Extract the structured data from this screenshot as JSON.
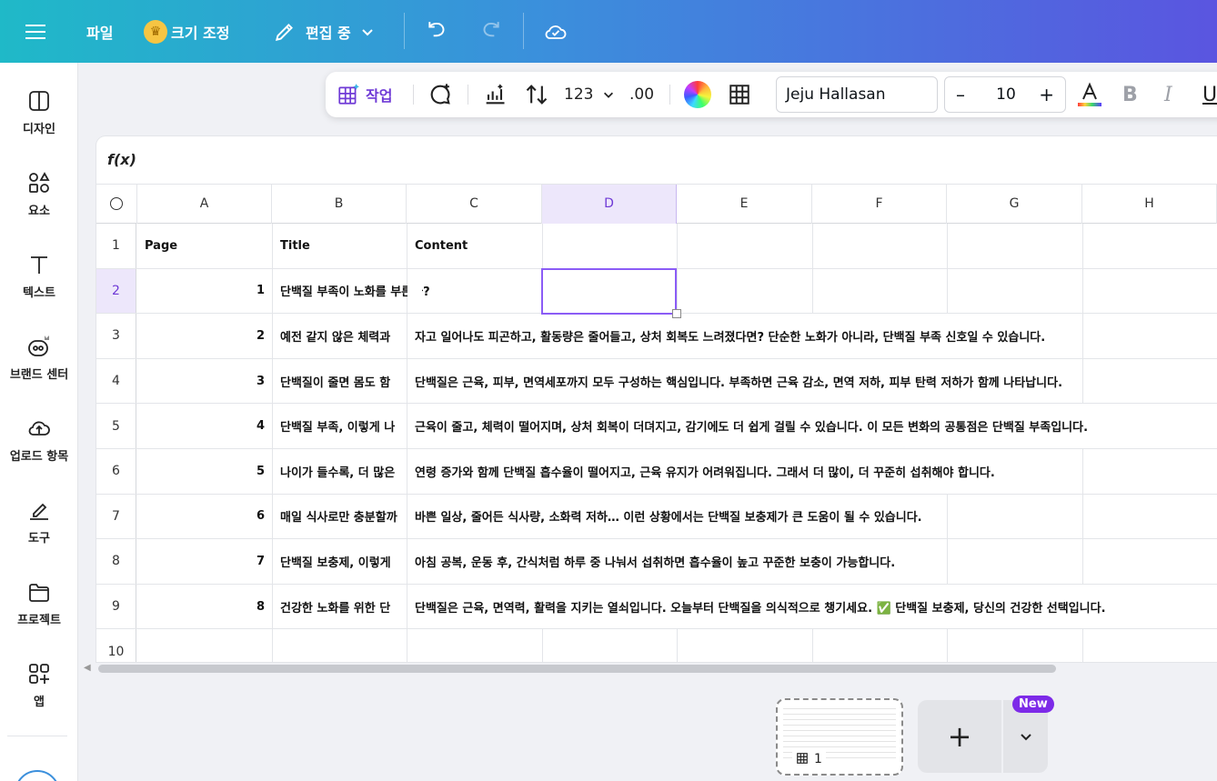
{
  "topbar": {
    "file_label": "파일",
    "resize_label": "크기 조정",
    "edit_mode_label": "편집 중"
  },
  "sidebar": {
    "items": [
      {
        "label": "디자인",
        "icon": "design-icon"
      },
      {
        "label": "요소",
        "icon": "elements-icon"
      },
      {
        "label": "텍스트",
        "icon": "text-icon"
      },
      {
        "label": "브랜드 센터",
        "icon": "brand-icon"
      },
      {
        "label": "업로드 항목",
        "icon": "upload-icon"
      },
      {
        "label": "도구",
        "icon": "tools-icon"
      },
      {
        "label": "프로젝트",
        "icon": "folder-icon"
      },
      {
        "label": "앱",
        "icon": "apps-icon"
      }
    ]
  },
  "toolbar": {
    "work_label": "작업",
    "number_format": "123",
    "decimal": ".00",
    "font_name": "Jeju Hallasan",
    "font_size": "10",
    "bold": "B",
    "italic": "I",
    "underline": "U"
  },
  "formula_bar": {
    "label": "f(x)"
  },
  "sheet": {
    "columns": [
      "A",
      "B",
      "C",
      "D",
      "E",
      "F",
      "G",
      "H"
    ],
    "selected_column": "D",
    "selected_row": "2",
    "rows": [
      {
        "num": "1",
        "a": "Page",
        "b": "Title",
        "c": "Content"
      },
      {
        "num": "2",
        "a": "1",
        "b": "단백질 부족이 노화를 부른다?",
        "c": ""
      },
      {
        "num": "3",
        "a": "2",
        "b": "예전 같지 않은 체력과",
        "c": "자고 일어나도 피곤하고, 활동량은 줄어들고, 상처 회복도 느려졌다면? 단순한 노화가 아니라, 단백질 부족 신호일 수 있습니다."
      },
      {
        "num": "4",
        "a": "3",
        "b": "단백질이 줄면 몸도 함",
        "c": "단백질은 근육, 피부, 면역세포까지 모두 구성하는 핵심입니다. 부족하면 근육 감소, 면역 저하, 피부 탄력 저하가 함께 나타납니다."
      },
      {
        "num": "5",
        "a": "4",
        "b": "단백질 부족, 이렇게 나",
        "c": "근육이 줄고, 체력이 떨어지며, 상처 회복이 더뎌지고, 감기에도 더 쉽게 걸릴 수 있습니다. 이 모든 변화의 공통점은 단백질 부족입니다."
      },
      {
        "num": "6",
        "a": "5",
        "b": "나이가 들수록, 더 많은",
        "c": "연령 증가와 함께 단백질 흡수율이 떨어지고, 근육 유지가 어려워집니다. 그래서 더 많이, 더 꾸준히 섭취해야 합니다."
      },
      {
        "num": "7",
        "a": "6",
        "b": "매일 식사로만 충분할까",
        "c": "바쁜 일상, 줄어든 식사량, 소화력 저하… 이런 상황에서는 단백질 보충제가 큰 도움이 될 수 있습니다."
      },
      {
        "num": "8",
        "a": "7",
        "b": "단백질 보충제, 이렇게",
        "c": "아침 공복, 운동 후, 간식처럼 하루 중 나눠서 섭취하면 흡수율이 높고 꾸준한 보충이 가능합니다."
      },
      {
        "num": "9",
        "a": "8",
        "b": "건강한 노화를 위한 단",
        "c": "단백질은 근육, 면역력, 활력을 지키는 열쇠입니다. 오늘부터 단백질을 의식적으로 챙기세요. ✅ 단백질 보충제, 당신의 건강한 선택입니다."
      },
      {
        "num": "10",
        "a": "",
        "b": "",
        "c": ""
      }
    ]
  },
  "pages": {
    "current_page": "1",
    "new_badge": "New"
  },
  "colors": {
    "accent": "#8b5cf6",
    "topbar_start": "#1fb9c8",
    "topbar_end": "#5a55e0"
  }
}
